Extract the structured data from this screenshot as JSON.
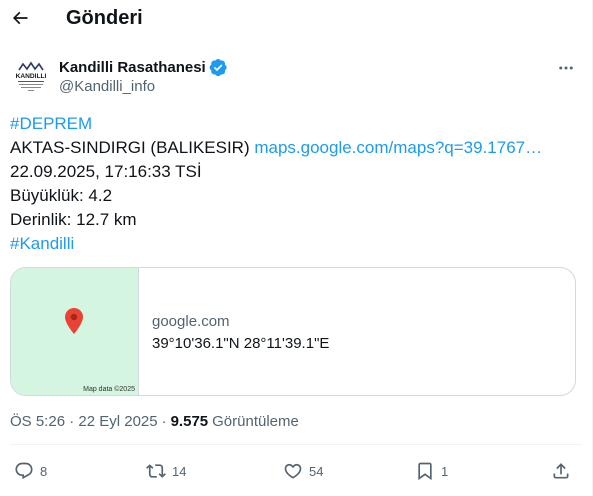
{
  "header": {
    "title": "Gönderi",
    "back_icon": "arrow-left-icon"
  },
  "author": {
    "name": "Kandilli Rasathanesi",
    "handle": "@Kandilli_info",
    "verified": true,
    "badge_color": "#1d9bf0",
    "avatar_text": "KANDILLI",
    "avatar_subtext": "RASATHANESI VE DEPREM ARAŞTIRMA ENSTİTÜSÜ"
  },
  "tweet": {
    "hashtag1": "#DEPREM",
    "location": "AKTAS-SINDIRGI (BALIKESIR)",
    "map_link": "maps.google.com/maps?q=39.1767…",
    "datetime": "22.09.2025, 17:16:33 TSİ",
    "magnitude": "Büyüklük: 4.2",
    "depth": "Derinlik: 12.7 km",
    "hashtag2": "#Kandilli"
  },
  "card": {
    "domain": "google.com",
    "title": "39°10'36.1\"N 28°11'39.1\"E",
    "map_attribution": "Map data ©2025"
  },
  "meta": {
    "time": "ÖS 5:26 · 22 Eyl 2025",
    "separator": "·",
    "views": "9.575",
    "views_label": "Görüntüleme"
  },
  "actions": {
    "replies": "8",
    "reposts": "14",
    "likes": "54",
    "bookmarks": "1"
  },
  "colors": {
    "accent": "#1d9bf0",
    "secondary": "#536471",
    "map_bg": "#d4f5e0",
    "pin": "#ea4335"
  }
}
